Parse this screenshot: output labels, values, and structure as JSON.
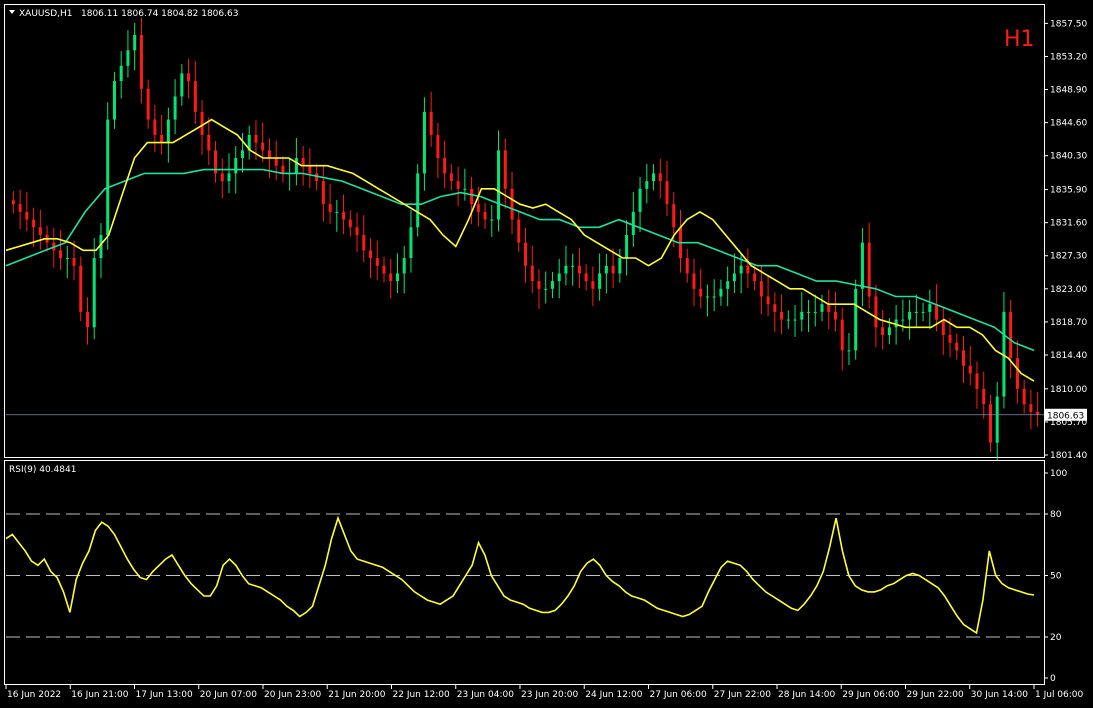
{
  "header": {
    "symbol": "XAUUSD,H1",
    "ohlc": "1806.11 1806.74 1804.82 1806.63",
    "timeframe_badge": "H1"
  },
  "rsi_header": "RSI(9) 40.4841",
  "colors": {
    "background": "#000000",
    "frame": "#ffffff",
    "bull": "#00e676",
    "bear": "#ff1a1a",
    "ma_fast": "#ffff33",
    "ma_slow": "#20e0a0",
    "rsi": "#ffff33",
    "price_line": "#8090b0"
  },
  "chart_data": [
    {
      "type": "candlestick",
      "name": "XAUUSD,H1",
      "ylim": [
        1801.4,
        1859.5
      ],
      "y_ticks": [
        "1857.50",
        "1853.20",
        "1848.90",
        "1844.60",
        "1840.30",
        "1835.90",
        "1831.60",
        "1827.30",
        "1823.00",
        "1818.70",
        "1814.40",
        "1810.00",
        "1805.70",
        "1801.40"
      ],
      "current_price": "1806.63",
      "x_labels": [
        "16 Jun 2022",
        "16 Jun 21:00",
        "17 Jun 13:00",
        "20 Jun 07:00",
        "20 Jun 23:00",
        "21 Jun 20:00",
        "22 Jun 12:00",
        "23 Jun 04:00",
        "23 Jun 20:00",
        "24 Jun 12:00",
        "27 Jun 06:00",
        "27 Jun 22:00",
        "28 Jun 14:00",
        "29 Jun 06:00",
        "29 Jun 22:00",
        "30 Jun 14:00",
        "1 Jul 06:00"
      ],
      "closes": [
        1834,
        1833,
        1832,
        1831,
        1830,
        1829,
        1828,
        1827,
        1827,
        1826,
        1820,
        1818,
        1827,
        1830,
        1845,
        1850,
        1852,
        1854,
        1856,
        1849,
        1845,
        1843,
        1842,
        1845,
        1848,
        1851,
        1850,
        1846,
        1843,
        1841,
        1838,
        1837,
        1838,
        1840,
        1841,
        1843,
        1842,
        1841,
        1840,
        1839,
        1838,
        1838,
        1840,
        1839,
        1838,
        1837,
        1834,
        1833,
        1833,
        1832,
        1831,
        1830,
        1828,
        1827,
        1826,
        1825,
        1824,
        1825,
        1827,
        1831,
        1838,
        1846,
        1843,
        1840,
        1838,
        1837,
        1836,
        1836,
        1834,
        1833,
        1832,
        1832,
        1841,
        1836,
        1832,
        1829,
        1826,
        1824,
        1823,
        1823,
        1824,
        1825,
        1826,
        1826,
        1825,
        1824,
        1823,
        1825,
        1826,
        1825,
        1827,
        1830,
        1833,
        1836,
        1837,
        1838,
        1837,
        1834,
        1831,
        1827,
        1825,
        1823,
        1822,
        1822,
        1822,
        1823,
        1824,
        1825,
        1826,
        1825,
        1824,
        1822,
        1821,
        1820,
        1819,
        1819,
        1819,
        1820,
        1820,
        1820,
        1821,
        1820,
        1819,
        1815,
        1815,
        1823,
        1829,
        1822,
        1818,
        1817,
        1818,
        1819,
        1819,
        1820,
        1820,
        1820,
        1821,
        1819,
        1817,
        1816,
        1815,
        1813,
        1812,
        1810,
        1808,
        1803,
        1809,
        1820,
        1814,
        1810,
        1808,
        1807,
        1806.63
      ],
      "ma_fast": [
        1828,
        1828.5,
        1829,
        1829.5,
        1829.5,
        1829,
        1828,
        1828,
        1830,
        1835,
        1840,
        1842,
        1842,
        1842,
        1843,
        1844,
        1845,
        1844,
        1843,
        1841,
        1840,
        1840,
        1840,
        1839,
        1839,
        1839,
        1838.5,
        1838,
        1837,
        1836,
        1835,
        1834,
        1833,
        1832,
        1830,
        1828.5,
        1832,
        1836,
        1836,
        1835,
        1834,
        1833.5,
        1834,
        1833,
        1832,
        1830,
        1829,
        1828,
        1827,
        1827,
        1826,
        1827,
        1830,
        1832,
        1833,
        1832,
        1830,
        1828,
        1826,
        1825,
        1824,
        1823,
        1823,
        1822,
        1821,
        1821,
        1821,
        1820,
        1819,
        1818.5,
        1818,
        1818,
        1818,
        1819,
        1818,
        1818,
        1817,
        1815,
        1814,
        1812,
        1811
      ],
      "ma_slow": [
        1826,
        1827,
        1828,
        1829,
        1833,
        1836,
        1837,
        1838,
        1838,
        1838,
        1838.5,
        1838.5,
        1838.5,
        1838.5,
        1838,
        1838,
        1837.5,
        1837,
        1836,
        1835,
        1834,
        1834,
        1835,
        1835.5,
        1835,
        1834,
        1833,
        1832,
        1832,
        1831,
        1831,
        1832,
        1831,
        1830,
        1829,
        1829,
        1828,
        1827,
        1826,
        1826,
        1825,
        1824,
        1824,
        1823.5,
        1823,
        1822,
        1822,
        1821,
        1820,
        1819,
        1818,
        1816,
        1815
      ]
    },
    {
      "type": "line",
      "name": "RSI(9)",
      "ylim": [
        0,
        100
      ],
      "y_ticks": [
        "100",
        "80",
        "50",
        "20",
        "0"
      ],
      "levels": [
        80,
        50,
        20
      ],
      "last_value": 40.4841,
      "values": [
        68,
        70,
        66,
        62,
        57,
        55,
        58,
        52,
        49,
        42,
        32,
        48,
        56,
        62,
        72,
        76,
        74,
        70,
        64,
        58,
        53,
        49,
        48,
        52,
        55,
        58,
        60,
        55,
        50,
        46,
        43,
        40,
        40,
        45,
        55,
        58,
        55,
        50,
        46,
        45,
        44,
        42,
        40,
        38,
        35,
        33,
        30,
        32,
        35,
        45,
        55,
        68,
        78,
        70,
        62,
        58,
        57,
        56,
        55,
        54,
        52,
        50,
        48,
        45,
        42,
        40,
        38,
        37,
        36,
        38,
        40,
        45,
        50,
        55,
        66,
        60,
        50,
        45,
        40,
        38,
        37,
        36,
        34,
        33,
        32,
        32,
        33,
        36,
        40,
        45,
        52,
        56,
        58,
        55,
        50,
        47,
        45,
        42,
        40,
        39,
        38,
        36,
        34,
        33,
        32,
        31,
        30,
        31,
        33,
        35,
        42,
        48,
        54,
        57,
        56,
        55,
        52,
        48,
        45,
        42,
        40,
        38,
        36,
        34,
        33,
        36,
        40,
        45,
        52,
        64,
        78,
        62,
        50,
        45,
        43,
        42,
        42,
        43,
        45,
        46,
        48,
        50,
        51,
        50,
        48,
        46,
        44,
        40,
        35,
        30,
        26,
        24,
        22,
        38,
        62,
        50,
        46,
        44,
        43,
        42,
        41,
        40.4841
      ]
    }
  ]
}
